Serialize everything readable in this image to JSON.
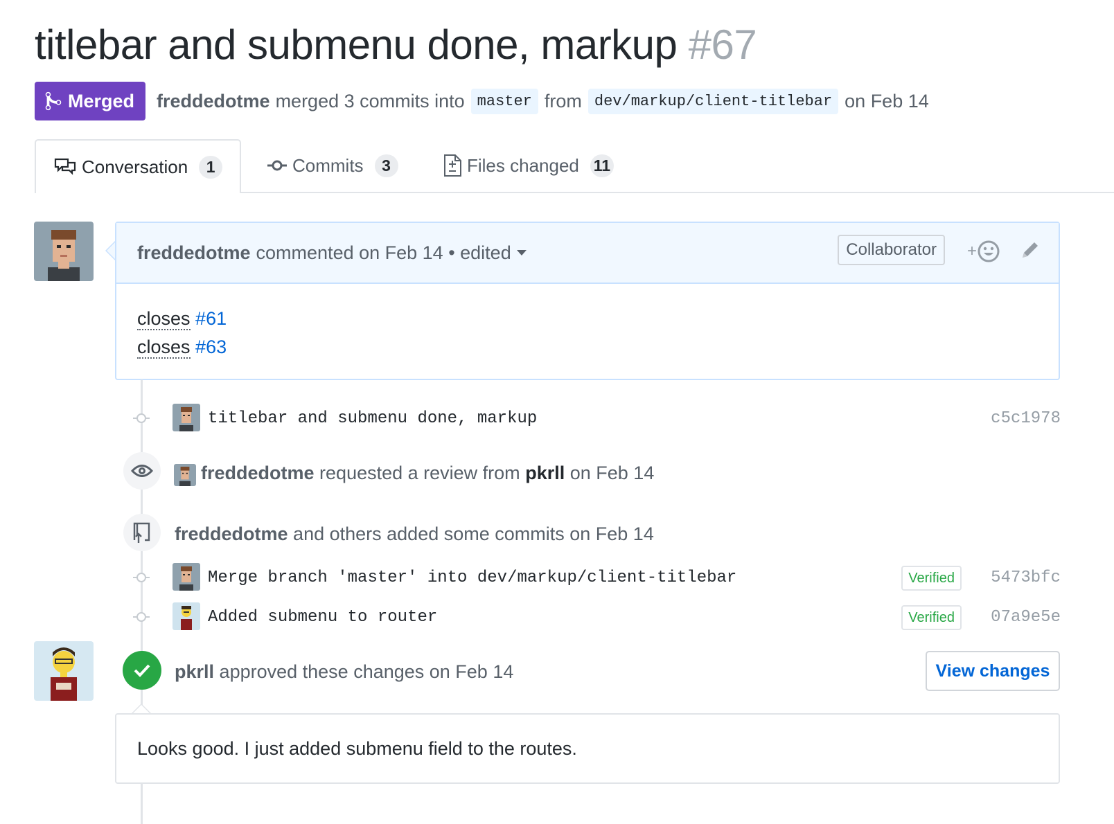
{
  "pr": {
    "title": "titlebar and submenu done, markup",
    "number": "#67",
    "state": "Merged",
    "author": "freddedotme",
    "merged_text": "merged 3 commits into",
    "base_branch": "master",
    "from_text": "from",
    "head_branch": "dev/markup/client-titlebar",
    "date_text": "on Feb 14"
  },
  "tabs": [
    {
      "label": "Conversation",
      "count": "1",
      "icon": "comment-discussion-icon"
    },
    {
      "label": "Commits",
      "count": "3",
      "icon": "git-commit-icon"
    },
    {
      "label": "Files changed",
      "count": "11",
      "icon": "file-diff-icon"
    }
  ],
  "comment": {
    "author": "freddedotme",
    "meta": "commented on Feb 14 • edited",
    "role": "Collaborator",
    "reaction_plus": "+",
    "lines": [
      {
        "word": "closes",
        "issue": "#61"
      },
      {
        "word": "closes",
        "issue": "#63"
      }
    ]
  },
  "timeline": {
    "commit1": {
      "message": "titlebar and submenu done, markup",
      "sha": "c5c1978"
    },
    "review_request": {
      "author": "freddedotme",
      "text": "requested a review from",
      "reviewer": "pkrll",
      "date": "on Feb 14"
    },
    "commits_added": {
      "author": "freddedotme",
      "text": "and others added some commits on Feb 14"
    },
    "commit2": {
      "message": "Merge branch 'master' into dev/markup/client-titlebar",
      "verified": "Verified",
      "sha": "5473bfc"
    },
    "commit3": {
      "message": "Added submenu to router",
      "verified": "Verified",
      "sha": "07a9e5e"
    },
    "approval": {
      "author": "pkrll",
      "text": "approved these changes on Feb 14",
      "button": "View changes"
    },
    "review_body": "Looks good. I just added submenu field to the routes."
  },
  "colors": {
    "merged_purple": "#6f42c1",
    "link_blue": "#0366d6",
    "success_green": "#28a745",
    "branch_bg": "#eaf5ff",
    "comment_header_bg": "#f1f8ff"
  }
}
